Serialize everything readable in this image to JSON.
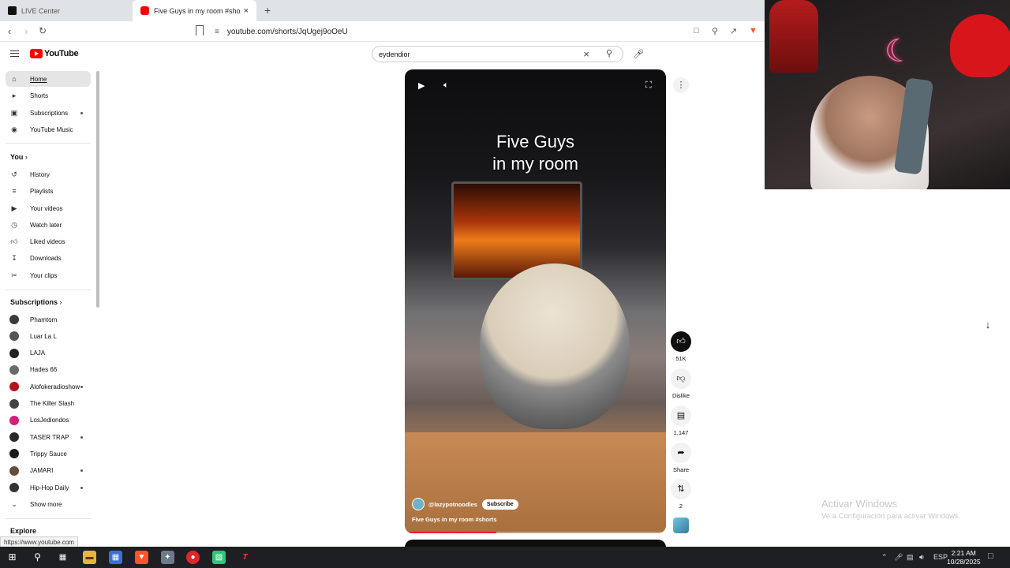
{
  "browser": {
    "tabs": [
      {
        "title": "LIVE Center"
      },
      {
        "title": "Five Guys in my room #shorts - YouTube"
      }
    ],
    "url": "youtube.com/shorts/JqUgej9oOeU",
    "status_url": "https://www.youtube.com"
  },
  "youtube": {
    "logo_text": "YouTube",
    "search_query": "eydendior"
  },
  "sidebar": {
    "main": [
      {
        "label": "Home",
        "icon": "home-icon"
      },
      {
        "label": "Shorts",
        "icon": "shorts-icon"
      },
      {
        "label": "Subscriptions",
        "icon": "subscriptions-icon"
      },
      {
        "label": "YouTube Music",
        "icon": "music-icon"
      }
    ],
    "you_header": "You",
    "you": [
      {
        "label": "History",
        "icon": "history-icon"
      },
      {
        "label": "Playlists",
        "icon": "playlists-icon"
      },
      {
        "label": "Your videos",
        "icon": "your-videos-icon"
      },
      {
        "label": "Watch later",
        "icon": "clock-icon"
      },
      {
        "label": "Liked videos",
        "icon": "thumbs-up-icon"
      },
      {
        "label": "Downloads",
        "icon": "download-icon"
      },
      {
        "label": "Your clips",
        "icon": "scissors-icon"
      }
    ],
    "subs_header": "Subscriptions",
    "subscriptions": [
      {
        "label": "Phamtom",
        "color": "#3a3a3a"
      },
      {
        "label": "Luar La L",
        "color": "#555555"
      },
      {
        "label": "LAJA",
        "color": "#222222"
      },
      {
        "label": "Hades 66",
        "color": "#6b6b6b"
      },
      {
        "label": "Alofokeradioshow",
        "color": "#b3141b"
      },
      {
        "label": "The Killer Slash",
        "color": "#444444"
      },
      {
        "label": "LosJediondos",
        "color": "#d61f7a"
      },
      {
        "label": "TASER TRAP",
        "color": "#2a2a2a"
      },
      {
        "label": "Trippy Sauce",
        "color": "#1a1a1a"
      },
      {
        "label": "JAMARI",
        "color": "#6a4a3a"
      },
      {
        "label": "Hip-Hop Daily",
        "color": "#333333"
      }
    ],
    "show_more": "Show more",
    "explore_header": "Explore"
  },
  "video": {
    "overlay_title_line1": "Five Guys",
    "overlay_title_line2": "in my room",
    "channel": "@lazypotnoodles",
    "subscribe": "Subscribe",
    "caption": "Five Guys in my room #shorts",
    "progress": 0.35
  },
  "actions": {
    "likes": "51K",
    "dislike": "Dislike",
    "comments": "1,147",
    "share": "Share",
    "remix": "2"
  },
  "watermark": {
    "line1": "Activar Windows",
    "line2": "Ve a Configuración para activar Windows."
  },
  "taskbar": {
    "lang": "ESP",
    "time": "2:21 AM",
    "date": "10/28/2025"
  }
}
